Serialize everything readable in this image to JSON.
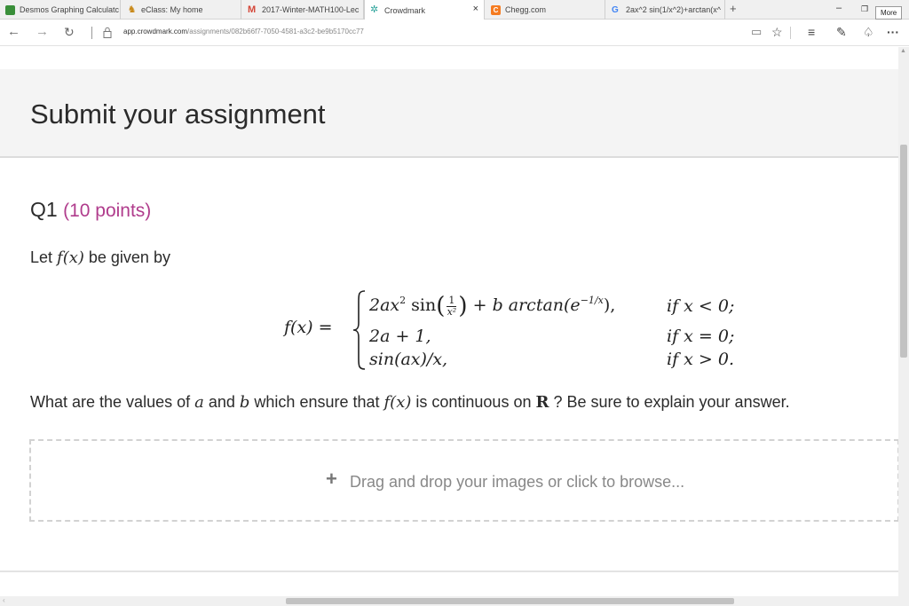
{
  "browser": {
    "tabs": [
      {
        "label": "Desmos Graphing Calculatc",
        "icon": "desmos-icon"
      },
      {
        "label": "eClass: My home",
        "icon": "eclass-icon"
      },
      {
        "label": "2017-Winter-MATH100-Lec",
        "icon": "gmail-icon"
      },
      {
        "label": "Crowdmark",
        "icon": "crowdmark-icon",
        "active": true
      },
      {
        "label": "Chegg.com",
        "icon": "chegg-icon"
      },
      {
        "label": "2ax^2 sin(1/x^2)+arctan(x^",
        "icon": "google-icon"
      }
    ],
    "tab_close_glyph": "×",
    "new_tab_glyph": "+",
    "more_tooltip": "More",
    "url_host": "app.crowdmark.com",
    "url_path": "/assignments/082b66f7-7050-4581-a3c2-be9b5170cc77",
    "more_menu_glyph": "···"
  },
  "page": {
    "title": "Submit your assignment",
    "question": {
      "label": "Q1",
      "points": "(10 points)",
      "intro_before": "Let ",
      "intro_fx": "f(x)",
      "intro_after": " be given by",
      "formula": {
        "lhs": "f(x) =",
        "row1_a": "2ax",
        "row1_sup": "2",
        "row1_sin": " sin",
        "row1_num": "1",
        "row1_den": "x²",
        "row1_b": "+ b arctan(e",
        "row1_exp": "−1/x",
        "row1_end": "),",
        "row2": "2a + 1,",
        "row3": "sin(ax)/x,",
        "cond1": "if x < 0;",
        "cond2": "if x = 0;",
        "cond3": "if x > 0."
      },
      "prompt_1": "What are the values of ",
      "prompt_a": "a",
      "prompt_2": " and ",
      "prompt_b": "b",
      "prompt_3": " which ensure that ",
      "prompt_fx": "f(x)",
      "prompt_4": " is continuous on ",
      "prompt_R": "R",
      "prompt_5": " ? Be sure to explain your answer."
    },
    "upload": {
      "plus": "+",
      "label": "Drag and drop your images or click to browse..."
    }
  },
  "colors": {
    "points_accent": "#b03c8c",
    "header_band": "#f4f4f4"
  }
}
